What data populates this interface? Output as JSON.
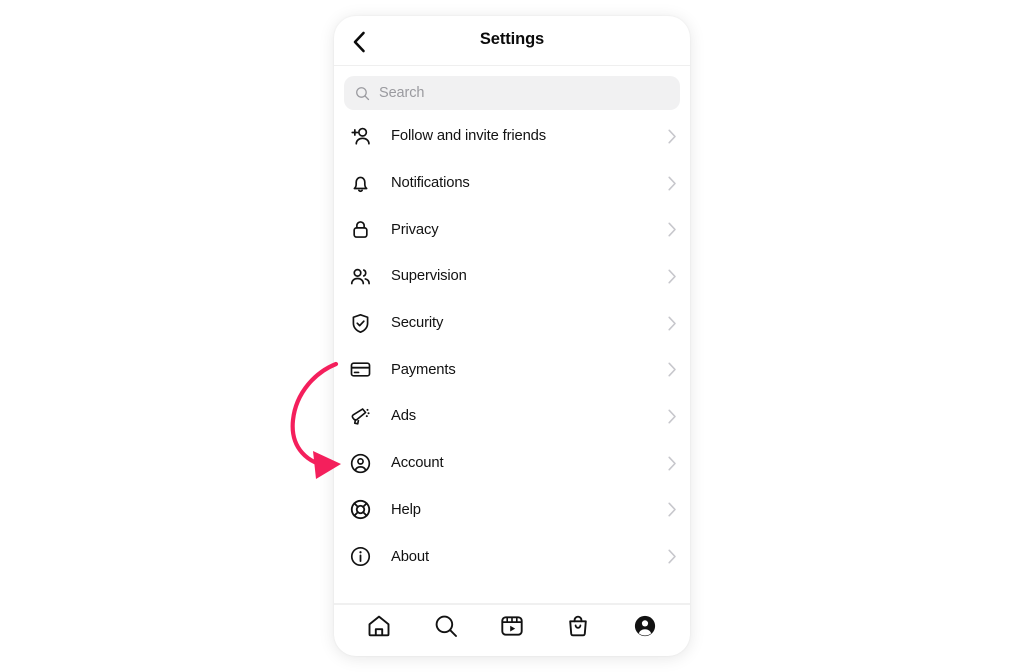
{
  "screen": {
    "background_color": "#ffffff",
    "card_background": "#ffffff"
  },
  "header": {
    "back_icon": "chevron-left-icon",
    "title": "Settings"
  },
  "search": {
    "icon": "search-icon",
    "placeholder": "Search",
    "value": "",
    "background_color": "#f1f1f2"
  },
  "settings_list": {
    "chevron_icon": "chevron-right-icon",
    "items": [
      {
        "label": "Follow and invite friends",
        "icon": "person-add-icon"
      },
      {
        "label": "Notifications",
        "icon": "bell-icon"
      },
      {
        "label": "Privacy",
        "icon": "lock-icon"
      },
      {
        "label": "Supervision",
        "icon": "people-icon"
      },
      {
        "label": "Security",
        "icon": "shield-check-icon"
      },
      {
        "label": "Payments",
        "icon": "credit-card-icon"
      },
      {
        "label": "Ads",
        "icon": "megaphone-icon"
      },
      {
        "label": "Account",
        "icon": "account-circle-icon"
      },
      {
        "label": "Help",
        "icon": "lifebuoy-icon"
      },
      {
        "label": "About",
        "icon": "info-circle-icon"
      }
    ]
  },
  "bottom_nav": {
    "items": [
      {
        "name": "home",
        "icon": "home-icon",
        "active": false
      },
      {
        "name": "search",
        "icon": "search-icon",
        "active": false
      },
      {
        "name": "reels",
        "icon": "reels-icon",
        "active": false
      },
      {
        "name": "shop",
        "icon": "shop-bag-icon",
        "active": false
      },
      {
        "name": "profile",
        "icon": "profile-filled-icon",
        "active": true
      }
    ]
  },
  "annotation": {
    "type": "curved-arrow",
    "color": "#f41f5c",
    "points_to": "Account",
    "stroke_width": 4
  }
}
